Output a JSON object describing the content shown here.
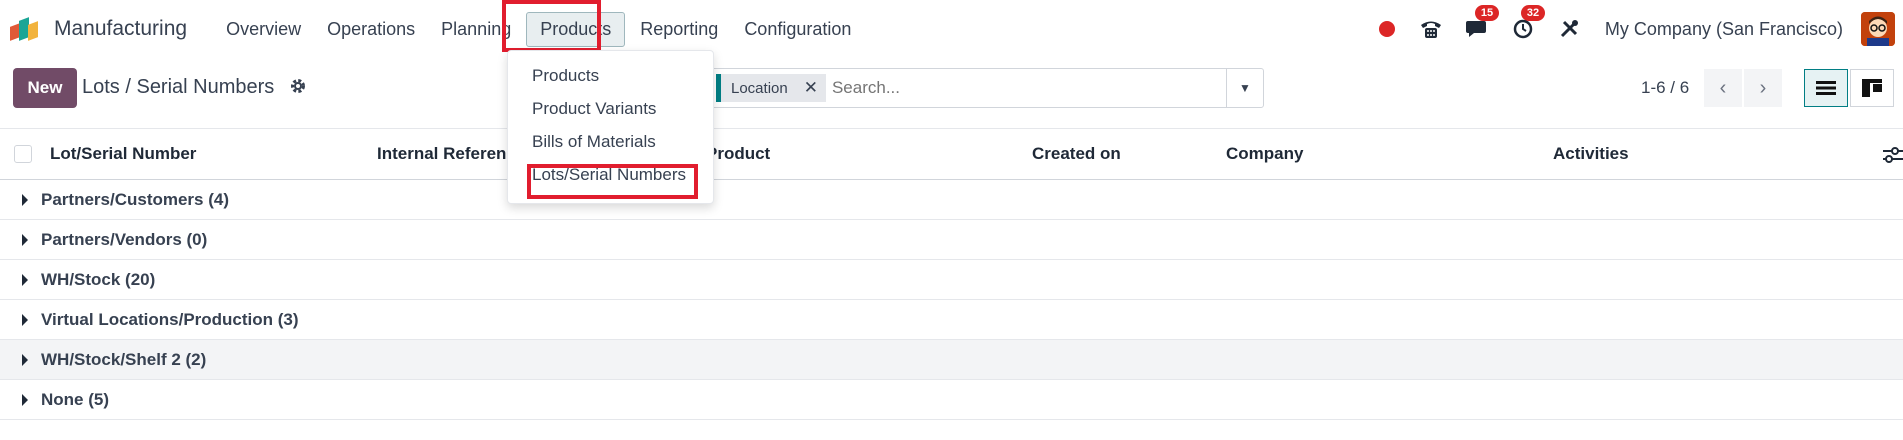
{
  "app": {
    "title": "Manufacturing"
  },
  "menu": [
    "Overview",
    "Operations",
    "Planning",
    "Products",
    "Reporting",
    "Configuration"
  ],
  "nav_right": {
    "messages_badge": "15",
    "activities_badge": "32",
    "company": "My Company (San Francisco)"
  },
  "control": {
    "new_label": "New",
    "breadcrumb": "Lots / Serial Numbers",
    "facet_label": "Location",
    "facet_remove": "✕",
    "search_placeholder": "Search...",
    "pager": "1-6 / 6"
  },
  "table": {
    "headers": [
      "Lot/Serial Number",
      "Internal Reference",
      "Product",
      "Created on",
      "Company",
      "Activities"
    ],
    "groups": [
      "Partners/Customers (4)",
      "Partners/Vendors (0)",
      "WH/Stock (20)",
      "Virtual Locations/Production (3)",
      "WH/Stock/Shelf 2 (2)",
      "None (5)"
    ]
  },
  "dropdown": {
    "items": [
      "Products",
      "Product Variants",
      "Bills of Materials",
      "Lots/Serial Numbers"
    ]
  },
  "colors": {
    "brand_primary": "#714b67",
    "accent_teal": "#017e84",
    "highlight": "#e11d2e",
    "badge": "#dc2626"
  }
}
